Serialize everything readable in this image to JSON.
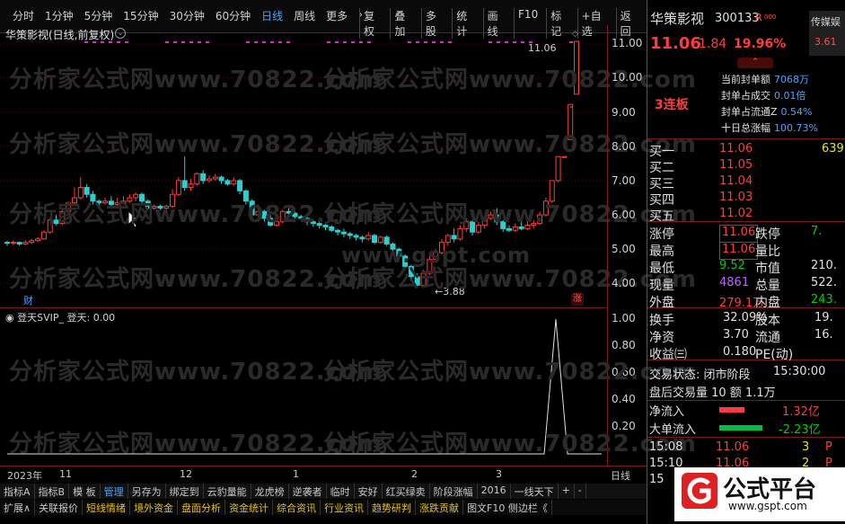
{
  "toolbar": {
    "periods": [
      "分时",
      "1分钟",
      "5分钟",
      "15分钟",
      "30分钟",
      "60分钟",
      "日线",
      "周线",
      "更多",
      "›"
    ],
    "active_period": "日线",
    "tools": [
      "复权",
      "叠加",
      "多股",
      "统计",
      "画线",
      "F10",
      "标记",
      "+自选",
      "返回"
    ]
  },
  "chart": {
    "title": "华策影视(日线,前复权)",
    "price_ticks": [
      "11.00",
      "10.00",
      "9.00",
      "8.00",
      "7.00",
      "6.00",
      "5.00",
      "4.00"
    ],
    "high_label": "11.06",
    "low_label": "3.88",
    "cai_label": "财",
    "zhang_label": "涨",
    "dash": "-"
  },
  "indicator": {
    "title": "登天SVIP_ 登天: 0.00",
    "ticks": [
      "1.00",
      "0.80",
      "0.60",
      "0.40",
      "0.20"
    ]
  },
  "date_axis": {
    "labels": [
      "2023年",
      "11",
      "12",
      "1",
      "2",
      "3"
    ],
    "period": "日线"
  },
  "tabs_row1": [
    "指标A",
    "指标B",
    "模 板",
    "管理",
    "另存为",
    "绑定到",
    "云豹量能",
    "龙虎榜",
    "逆袭者",
    "临时",
    "安好",
    "红买绿卖",
    "阶段涨幅",
    "2016",
    "一线天下",
    "+",
    "-"
  ],
  "tabs_row2": [
    "扩展∧",
    "关联报价",
    "短线情绪",
    "境外资金",
    "盘面分析",
    "资金统计",
    "综合资讯",
    "行业资讯",
    "趋势研判",
    "涨跌贡献",
    "图文F10 侧边栏《"
  ],
  "watermark": {
    "site": "分析家公式网",
    "url": "www.70822.com",
    "gspt": "www.gspt.com"
  },
  "quote": {
    "name": "华策影视",
    "code": "300133",
    "flag": "R",
    "flag2": "000",
    "price": "11.06",
    "change": "1.84",
    "pct": "19.96%",
    "side_tag": "传媒娱",
    "side_val": "3.61",
    "lianban": "3连板",
    "seal_rows": [
      {
        "k": "当前封单额",
        "v": "7068万"
      },
      {
        "k": "封单占成交",
        "v": "0.01倍"
      },
      {
        "k": "封单占流通Z",
        "v": "0.54%"
      },
      {
        "k": "十日总涨幅",
        "v": "100.73%"
      }
    ],
    "bids": [
      {
        "k": "买一",
        "p": "11.06",
        "v": "639"
      },
      {
        "k": "买二",
        "p": "11.05",
        "v": ""
      },
      {
        "k": "买三",
        "p": "11.04",
        "v": ""
      },
      {
        "k": "买四",
        "p": "11.03",
        "v": ""
      },
      {
        "k": "买五",
        "p": "11.02",
        "v": ""
      }
    ],
    "stats": [
      {
        "k": "涨停",
        "v": "11.06",
        "k2": "跌停",
        "v2": "7."
      },
      {
        "k": "最高",
        "v": "11.06",
        "k2": "量比",
        "v2": ""
      },
      {
        "k": "最低",
        "v": "9.52",
        "k2": "市值",
        "v2": "210."
      },
      {
        "k": "现量",
        "v": "4861",
        "k2": "总量",
        "v2": "522."
      },
      {
        "k": "外盘",
        "v": "279.1万",
        "k2": "内盘",
        "v2": "243."
      }
    ],
    "fund": [
      {
        "k": "换手",
        "v": "32.09%",
        "k2": "股本",
        "v2": "19."
      },
      {
        "k": "净资",
        "v": "3.70",
        "k2": "流通",
        "v2": "16."
      },
      {
        "k": "收益㈢",
        "v": "0.180",
        "k2": "PE(动)",
        "v2": ""
      }
    ],
    "trade_status": "交易状态: 闭市阶段",
    "trade_time": "15:30:00",
    "after_hours": "盘后交易量 10 额 1.1万",
    "net_in_label": "净流入",
    "net_in": "1.32亿",
    "big_in_label": "大单流入",
    "big_in": "-2.23亿",
    "ticks": [
      {
        "t": "15:08",
        "p": "11.06",
        "v": "3",
        "s": "P"
      },
      {
        "t": "15:10",
        "p": "11.06",
        "v": "2",
        "s": "P"
      },
      {
        "t": "15",
        "p": "",
        "v": "",
        "s": ""
      }
    ]
  },
  "brand": {
    "name": "公式平台",
    "url": "www.gspt.com"
  },
  "candles": [
    [
      5.2,
      5.18,
      5.1,
      5.25
    ],
    [
      5.18,
      5.2,
      5.12,
      5.26
    ],
    [
      5.2,
      5.15,
      5.1,
      5.22
    ],
    [
      5.15,
      5.2,
      5.12,
      5.26
    ],
    [
      5.2,
      5.25,
      5.15,
      5.3
    ],
    [
      5.25,
      5.3,
      5.2,
      5.35
    ],
    [
      5.3,
      5.5,
      5.28,
      5.55
    ],
    [
      5.5,
      5.85,
      5.45,
      5.9
    ],
    [
      5.85,
      5.75,
      5.7,
      6.0
    ],
    [
      5.75,
      6.1,
      5.7,
      6.2
    ],
    [
      6.1,
      6.35,
      6.0,
      6.4
    ],
    [
      6.35,
      6.5,
      6.3,
      6.8
    ],
    [
      6.5,
      6.8,
      6.45,
      7.1
    ],
    [
      6.8,
      6.6,
      6.5,
      6.9
    ],
    [
      6.6,
      6.4,
      6.3,
      6.7
    ],
    [
      6.4,
      6.35,
      6.25,
      6.45
    ],
    [
      6.35,
      6.4,
      6.3,
      6.5
    ],
    [
      6.4,
      6.3,
      6.2,
      6.55
    ],
    [
      6.3,
      6.35,
      6.25,
      6.5
    ],
    [
      6.35,
      6.4,
      6.3,
      6.55
    ],
    [
      6.4,
      6.5,
      6.35,
      6.6
    ],
    [
      6.5,
      6.6,
      6.4,
      6.65
    ],
    [
      6.6,
      6.4,
      6.3,
      6.65
    ],
    [
      6.4,
      6.2,
      6.15,
      6.45
    ],
    [
      6.2,
      6.25,
      6.15,
      6.3
    ],
    [
      6.25,
      6.2,
      6.15,
      6.3
    ],
    [
      6.2,
      6.25,
      6.15,
      6.3
    ],
    [
      6.25,
      6.6,
      6.2,
      6.75
    ],
    [
      6.6,
      7.0,
      6.55,
      7.1
    ],
    [
      7.0,
      6.8,
      6.7,
      7.7
    ],
    [
      6.8,
      6.9,
      6.7,
      7.05
    ],
    [
      6.9,
      7.2,
      6.85,
      7.25
    ],
    [
      7.2,
      7.0,
      6.9,
      7.3
    ],
    [
      7.0,
      7.05,
      6.95,
      7.15
    ],
    [
      7.05,
      7.1,
      7.0,
      7.2
    ],
    [
      7.1,
      7.0,
      6.9,
      7.15
    ],
    [
      7.0,
      6.9,
      6.85,
      7.05
    ],
    [
      6.9,
      7.0,
      6.85,
      7.1
    ],
    [
      7.0,
      6.7,
      6.6,
      7.05
    ],
    [
      6.7,
      6.4,
      6.3,
      6.75
    ],
    [
      6.4,
      6.0,
      5.95,
      6.45
    ],
    [
      6.0,
      6.1,
      5.9,
      6.3
    ],
    [
      6.1,
      5.9,
      5.8,
      6.15
    ],
    [
      5.9,
      5.7,
      5.65,
      6.0
    ],
    [
      5.7,
      5.8,
      5.65,
      5.9
    ],
    [
      5.8,
      6.1,
      5.75,
      6.15
    ],
    [
      6.1,
      6.05,
      5.95,
      6.2
    ],
    [
      6.05,
      5.95,
      5.9,
      6.1
    ],
    [
      5.95,
      5.9,
      5.85,
      6.0
    ],
    [
      5.9,
      5.8,
      5.7,
      5.95
    ],
    [
      5.8,
      5.75,
      5.65,
      5.85
    ],
    [
      5.75,
      5.7,
      5.6,
      5.8
    ],
    [
      5.7,
      5.65,
      5.55,
      5.75
    ],
    [
      5.65,
      5.55,
      5.5,
      5.7
    ],
    [
      5.55,
      5.5,
      5.4,
      5.6
    ],
    [
      5.5,
      5.45,
      5.35,
      5.6
    ],
    [
      5.45,
      5.4,
      5.3,
      5.5
    ],
    [
      5.4,
      5.35,
      5.25,
      5.45
    ],
    [
      5.35,
      5.3,
      5.2,
      5.4
    ],
    [
      5.3,
      5.4,
      5.25,
      5.5
    ],
    [
      5.4,
      5.2,
      5.15,
      5.45
    ],
    [
      5.2,
      5.35,
      5.15,
      5.4
    ],
    [
      5.35,
      5.15,
      5.1,
      5.4
    ],
    [
      5.15,
      5.0,
      4.95,
      5.2
    ],
    [
      5.0,
      4.8,
      4.7,
      5.05
    ],
    [
      4.8,
      4.5,
      4.4,
      4.85
    ],
    [
      4.5,
      4.2,
      4.1,
      4.55
    ],
    [
      4.2,
      3.95,
      3.88,
      4.3
    ],
    [
      3.95,
      4.3,
      3.9,
      4.4
    ],
    [
      4.3,
      4.7,
      4.25,
      4.8
    ],
    [
      4.7,
      4.9,
      4.6,
      5.0
    ],
    [
      4.9,
      5.2,
      4.85,
      5.3
    ],
    [
      5.2,
      5.4,
      5.1,
      5.45
    ],
    [
      5.4,
      5.3,
      5.2,
      5.6
    ],
    [
      5.3,
      5.6,
      5.25,
      5.7
    ],
    [
      5.6,
      5.8,
      5.5,
      5.9
    ],
    [
      5.8,
      5.5,
      5.4,
      5.85
    ],
    [
      5.5,
      5.7,
      5.45,
      5.8
    ],
    [
      5.7,
      5.9,
      5.6,
      6.0
    ],
    [
      5.9,
      6.0,
      5.85,
      6.1
    ],
    [
      6.0,
      5.8,
      5.7,
      6.2
    ],
    [
      5.8,
      5.6,
      5.5,
      5.85
    ],
    [
      5.6,
      5.55,
      5.5,
      5.7
    ],
    [
      5.55,
      5.65,
      5.5,
      5.75
    ],
    [
      5.65,
      5.6,
      5.55,
      5.8
    ],
    [
      5.6,
      5.7,
      5.55,
      5.9
    ],
    [
      5.7,
      5.75,
      5.6,
      5.85
    ],
    [
      5.75,
      6.0,
      5.7,
      6.1
    ],
    [
      6.0,
      6.4,
      5.95,
      6.5
    ],
    [
      6.4,
      7.0,
      6.35,
      7.0
    ],
    [
      7.0,
      7.7,
      6.95,
      7.7
    ],
    [
      7.7,
      7.7,
      7.7,
      7.7
    ],
    [
      8.2,
      9.22,
      8.2,
      9.22
    ],
    [
      9.52,
      11.06,
      9.52,
      11.06
    ]
  ]
}
